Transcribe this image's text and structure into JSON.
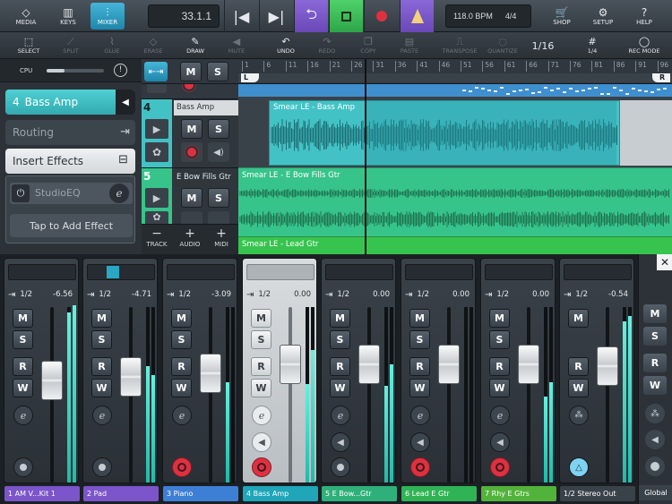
{
  "toolbar": {
    "media_label": "MEDIA",
    "keys_label": "KEYS",
    "mixer_label": "MIXER",
    "position": "33.1.1",
    "tempo": "118.0 BPM",
    "time_signature": "4/4",
    "shop_label": "SHOP",
    "setup_label": "SETUP",
    "help_label": "HELP"
  },
  "tools": {
    "select": "SELECT",
    "split": "SPLIT",
    "glue": "GLUE",
    "erase": "ERASE",
    "draw": "DRAW",
    "mute": "MUTE",
    "undo": "UNDO",
    "redo": "REDO",
    "copy": "COPY",
    "paste": "PASTE",
    "transpose": "TRANSPOSE",
    "quantize": "QUANTIZE",
    "quantize_value": "1/16",
    "grid_value": "1/4",
    "rec_mode": "REC MODE"
  },
  "inspector": {
    "cpu_label": "CPU",
    "track_number": "4",
    "track_name": "Bass Amp",
    "routing_label": "Routing",
    "insert_effects_label": "Insert Effects",
    "effect_name": "StudioEQ",
    "add_effect_label": "Tap to Add Effect"
  },
  "tracks": [
    {
      "number": "4",
      "name": "Bass Amp"
    },
    {
      "number": "5",
      "name": "E Bow Fills Gtr"
    }
  ],
  "track_buttons": {
    "track": "TRACK",
    "audio": "AUDIO",
    "midi": "MIDI"
  },
  "ruler": {
    "ticks": [
      "1",
      "6",
      "11",
      "16",
      "21",
      "26",
      "31",
      "36",
      "41",
      "46",
      "51",
      "56",
      "61",
      "66",
      "71",
      "76",
      "81",
      "86",
      "91",
      "96"
    ],
    "left_locator": "L",
    "right_locator": "R"
  },
  "clips": {
    "bass": "Smear LE - Bass Amp",
    "ebow": "Smear LE - E Bow Fills Gtr",
    "lead": "Smear LE - Lead Gtr"
  },
  "mixer": {
    "channels": [
      {
        "name": "1  AM V...Kit 1",
        "io": "1/2",
        "volume": "-6.56",
        "color": "#7b55c9"
      },
      {
        "name": "2  Pad",
        "io": "1/2",
        "volume": "-4.71",
        "color": "#7b55c9"
      },
      {
        "name": "3  Piano",
        "io": "1/2",
        "volume": "-3.09",
        "color": "#3e7fd6"
      },
      {
        "name": "4  Bass Amp",
        "io": "1/2",
        "volume": "0.00",
        "color": "#1fa6b8"
      },
      {
        "name": "5  E Bow...Gtr",
        "io": "1/2",
        "volume": "0.00",
        "color": "#2fb07a"
      },
      {
        "name": "6  Lead E Gtr",
        "io": "1/2",
        "volume": "0.00",
        "color": "#30b355"
      },
      {
        "name": "7  Rhy E Gtrs",
        "io": "1/2",
        "volume": "0.00",
        "color": "#52b33a"
      },
      {
        "name": "1/2 Stereo Out",
        "io": "1/2",
        "volume": "-0.54",
        "color": "#3a4249"
      }
    ],
    "global_label": "Global",
    "mute_label": "M",
    "solo_label": "S",
    "read_label": "R",
    "write_label": "W"
  },
  "colors": {
    "accent": "#2bb3d6",
    "track_teal": "#43c2c6",
    "track_green": "#37c48a",
    "record": "#e03040",
    "transport_purple": "#7a5ac8",
    "transport_green": "#3dc25a"
  }
}
